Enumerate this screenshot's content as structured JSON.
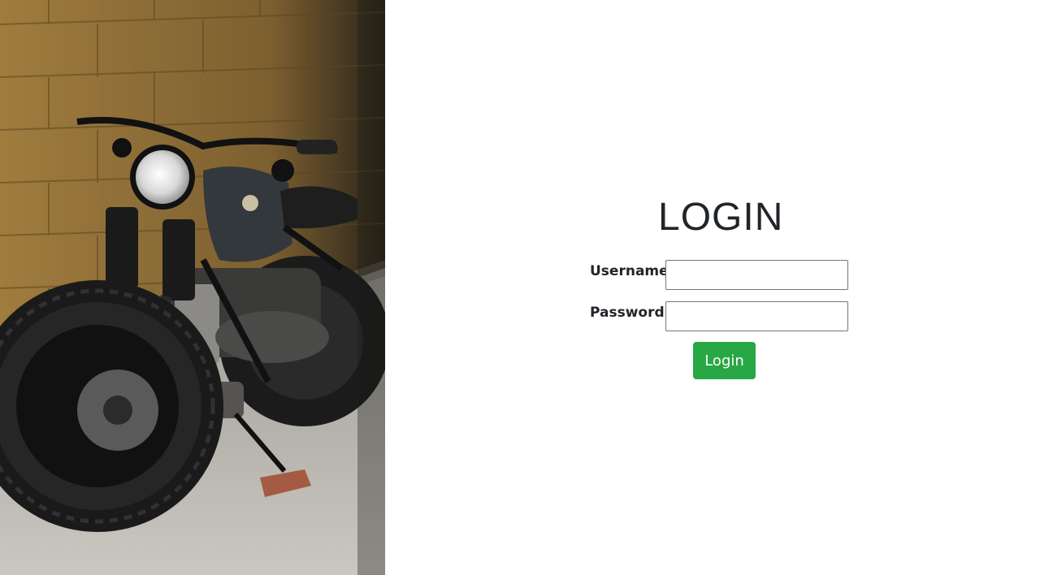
{
  "hero": {
    "image_subject": "motorcycle-photo"
  },
  "login": {
    "title": "LOGIN",
    "username_label": "Username",
    "username_value": "",
    "password_label": "Password",
    "password_value": "",
    "button_label": "Login"
  },
  "colors": {
    "button_bg": "#28a745",
    "button_text": "#ffffff",
    "text": "#212529",
    "background": "#ffffff"
  }
}
